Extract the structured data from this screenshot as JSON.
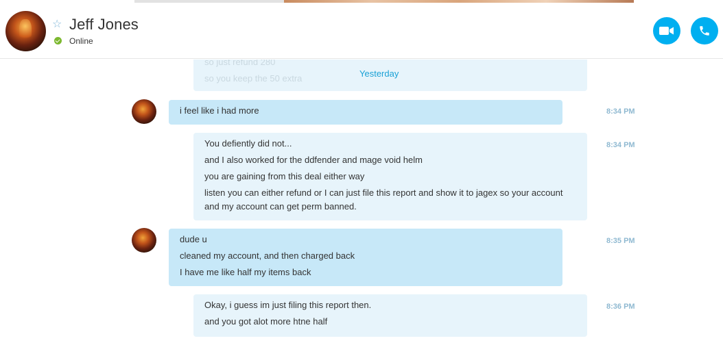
{
  "header": {
    "contact_name": "Jeff Jones",
    "status": "Online",
    "status_color": "#7cb82f",
    "accent_color": "#00aff0",
    "favorite_icon": "star-outline-icon",
    "video_icon": "video-camera-icon",
    "call_icon": "phone-icon"
  },
  "conversation": {
    "faded_above": [
      "so just refund 280",
      "so you keep the 50 extra"
    ],
    "date_divider": "Yesterday",
    "messages": [
      {
        "sender": "contact",
        "time": "8:34 PM",
        "lines": [
          "i feel like i had more"
        ]
      },
      {
        "sender": "self",
        "time": "8:34 PM",
        "lines": [
          "You defiently did not...",
          "and I also worked for the ddfender and mage void helm",
          "you are gaining from this deal either way",
          "listen you can either refund or I can just file this report and show it to jagex so your account",
          "and my account can get perm banned."
        ]
      },
      {
        "sender": "contact",
        "time": "8:35 PM",
        "lines": [
          "dude u",
          "cleaned my account, and then charged back",
          "I have me like half my items back"
        ]
      },
      {
        "sender": "self",
        "time": "8:36 PM",
        "lines": [
          "Okay, i guess im just filing this report then.",
          "and you got alot more htne half"
        ]
      }
    ]
  }
}
